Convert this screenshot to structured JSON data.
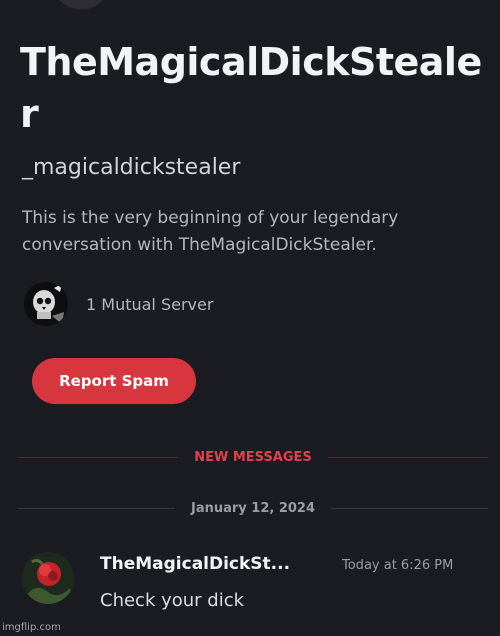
{
  "profile": {
    "display_name": "TheMagicalDickStealer",
    "username": "_magicaldickstealer",
    "intro_text": "This is the very beginning of your legendary conversation with TheMagicalDickStealer."
  },
  "mutual": {
    "label": "1 Mutual Server",
    "server_icon": "skull-server-icon"
  },
  "actions": {
    "report_spam_label": "Report Spam"
  },
  "dividers": {
    "new_messages_label": "NEW MESSAGES",
    "date_label": "January 12, 2024"
  },
  "message": {
    "author": "TheMagicalDickSt...",
    "timestamp": "Today at 6:26 PM",
    "content": "Check your dick",
    "avatar_icon": "red-flower-avatar"
  },
  "watermark": {
    "text": "imgflip.com"
  },
  "colors": {
    "background": "#1b1b22",
    "report_button": "#d8363f",
    "new_messages": "#e0424c",
    "text_primary": "#f2f3f5",
    "text_muted": "#9a9da3"
  }
}
